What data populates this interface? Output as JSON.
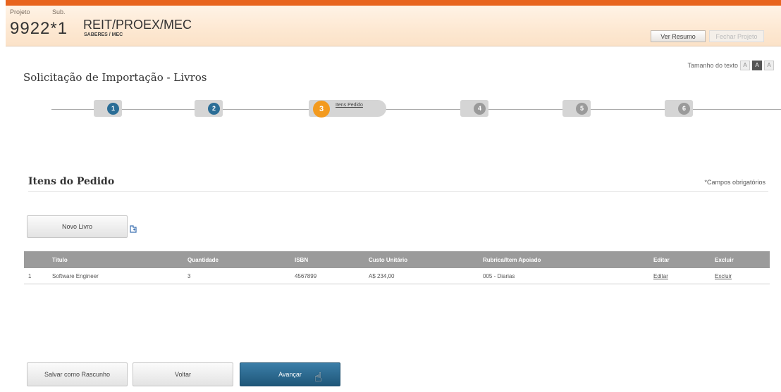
{
  "header": {
    "project_label": "Projeto",
    "sub_label": "Sub.",
    "project_number": "9922*1",
    "title": "REIT/PROEX/MEC",
    "subtitle": "SABERES / MEC",
    "view_summary": "Ver Resumo",
    "disabled_button": "Fechar Projeto"
  },
  "text_size": {
    "label": "Tamanho do texto",
    "small": "A",
    "medium": "A",
    "large": "A"
  },
  "page_title": "Solicitação de Importação - Livros",
  "steps": [
    {
      "num": "1"
    },
    {
      "num": "2"
    },
    {
      "num": "3",
      "label": "Itens Pedido"
    },
    {
      "num": "4"
    },
    {
      "num": "5"
    },
    {
      "num": "6"
    }
  ],
  "section": {
    "title": "Itens do Pedido",
    "required_note": "*Campos obrigatórios",
    "new_book": "Novo Livro"
  },
  "table": {
    "headers": [
      "",
      "Título",
      "Quantidade",
      "ISBN",
      "Custo Unitário",
      "Rubrica/Item Apoiado",
      "Editar",
      "Excluir"
    ],
    "rows": [
      [
        "1",
        "Software Engineer",
        "3",
        "4567899",
        "A$ 234,00",
        "005 - Diarias",
        "Editar",
        "Excluir"
      ]
    ]
  },
  "footer": {
    "save_draft": "Salvar como Rascunho",
    "back": "Voltar",
    "next": "Avançar"
  }
}
